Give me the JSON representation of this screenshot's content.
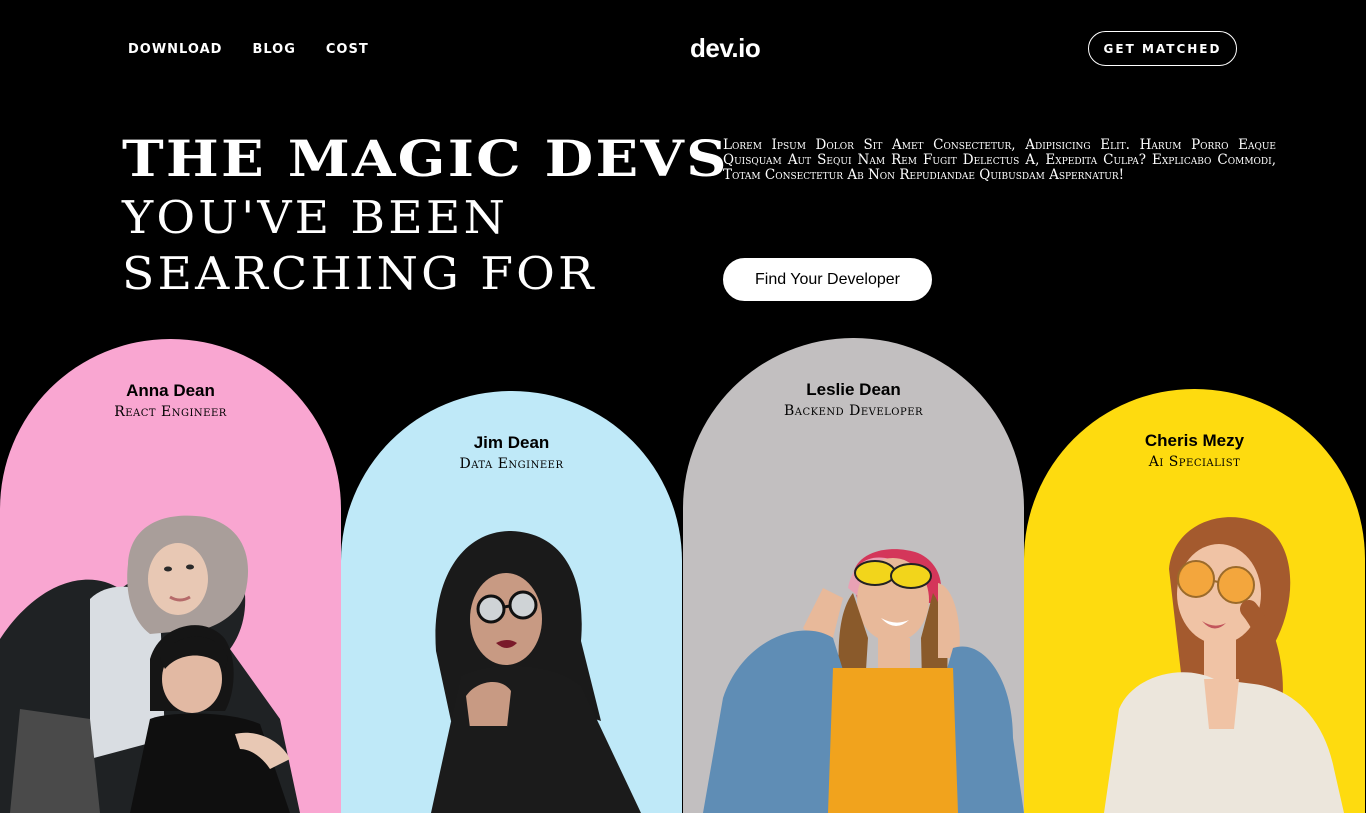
{
  "nav": {
    "links": [
      "DOWNLOAD",
      "BLOG",
      "COST"
    ],
    "logo": "dev.io",
    "cta": "GET MATCHED"
  },
  "hero": {
    "title_line1": "THE MAGIC DEVS",
    "title_line2": "YOU'VE BEEN",
    "title_line3": "SEARCHING FOR",
    "description": "Lorem Ipsum Dolor Sit Amet Consectetur, Adipisicing Elit. Harum Porro Eaque Quisquam Aut Sequi Nam Rem Fugit Delectus A, Expedita Culpa? Explicabo Commodi, Totam Consectetur Ab Non Repudiandae Quibusdam Aspernatur!",
    "button": "Find Your Developer"
  },
  "developers": [
    {
      "name": "Anna Dean",
      "role": "React Engineer",
      "color": "#f9a6d1"
    },
    {
      "name": "Jim Dean",
      "role": "Data Engineer",
      "color": "#bfe9f8"
    },
    {
      "name": "Leslie Dean",
      "role": "Backend Developer",
      "color": "#c2bfc0"
    },
    {
      "name": "Cheris Mezy",
      "role": "Ai Specialist",
      "color": "#fedb0f"
    }
  ]
}
